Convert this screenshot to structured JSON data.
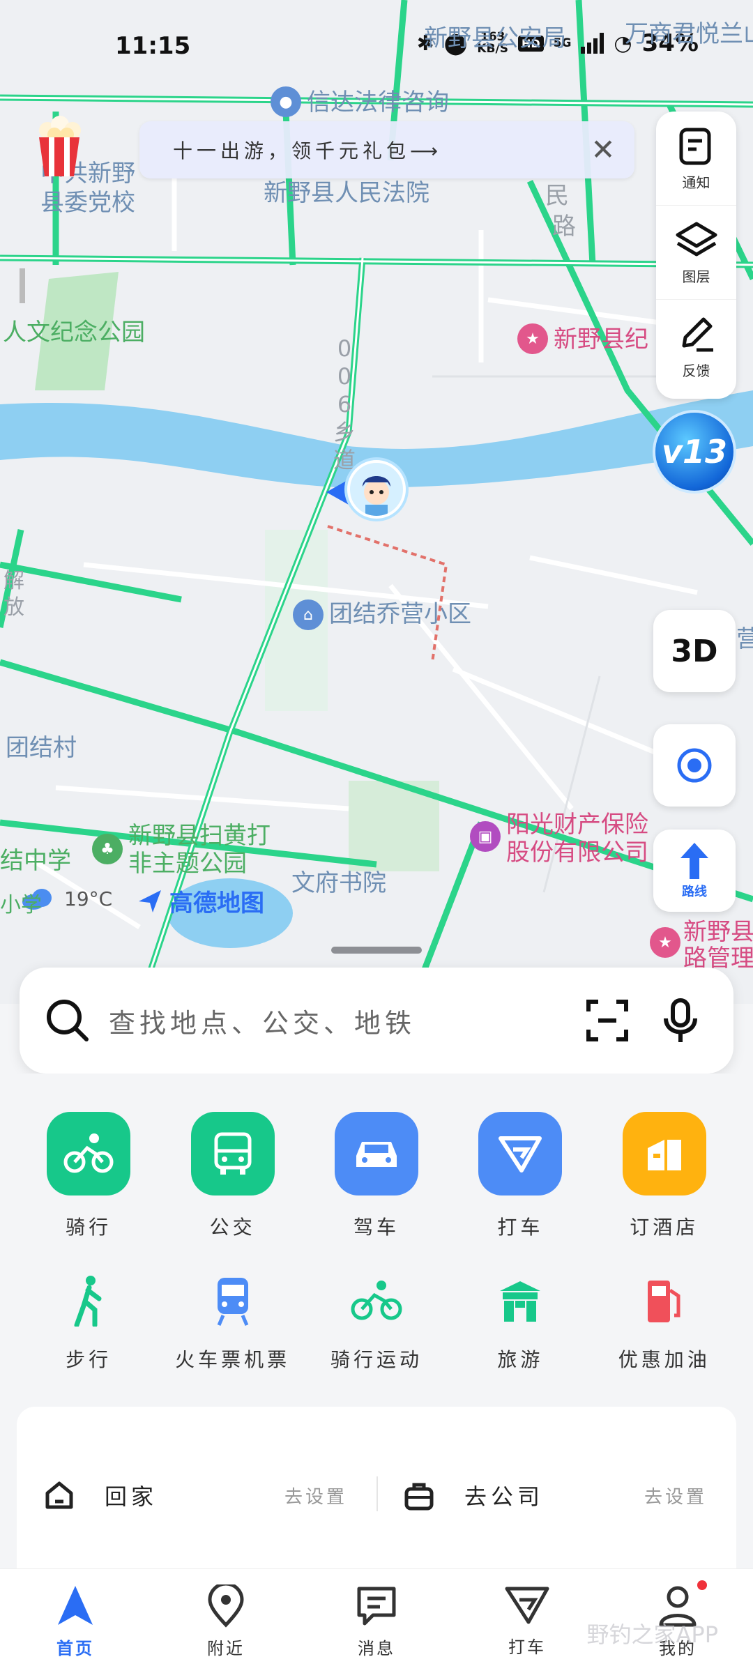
{
  "status_bar": {
    "time": "11:15",
    "net_speed": "163",
    "net_unit": "KB/S",
    "hd": "HD",
    "network": "5G",
    "battery": "34%"
  },
  "map": {
    "labels": {
      "public_security": "新野县公安局",
      "hotel": "万商君悦兰山",
      "law_consult": "信达法律咨询",
      "party_school_1": "中共新野",
      "party_school_2": "县委党校",
      "court": "新野县人民法院",
      "min_road_1": "民",
      "min_road_2": "路",
      "memorial_park": "人文纪念公园",
      "xinye_county": "新野县纪",
      "road_006": "006乡道",
      "jie_road": "解放",
      "community": "团结乔营小区",
      "village": "团结村",
      "theme_park_1": "新野县扫黄打",
      "theme_park_2": "非主题公园",
      "insurance_1": "阳光财产保险",
      "insurance_2": "股份有限公司",
      "academy": "文府书院",
      "school_left": "结中学",
      "school_left_2": "小学",
      "road_mgmt_1": "新野县",
      "road_mgmt_2": "路管理",
      "right_edge": "营"
    },
    "weather_temp": "19°C",
    "brand": "高德地图",
    "promo_text": "十一出游，领千元礼包⟶",
    "promo_close": "✕"
  },
  "toolbar": {
    "notice_label": "通知",
    "layers_label": "图层",
    "feedback_label": "反馈",
    "version_badge": "v13",
    "btn_3d": "3D",
    "route_label": "路线"
  },
  "search": {
    "placeholder": "查找地点、公交、地铁"
  },
  "quick_actions": {
    "row1": [
      {
        "label": "骑行",
        "color": "#17c88a"
      },
      {
        "label": "公交",
        "color": "#17c88a"
      },
      {
        "label": "驾车",
        "color": "#4d8cf6"
      },
      {
        "label": "打车",
        "color": "#4d8cf6"
      },
      {
        "label": "订酒店",
        "color": "#ffb20f"
      }
    ],
    "row2": [
      {
        "label": "步行",
        "color": "#17c88a"
      },
      {
        "label": "火车票机票",
        "color": "#4d8cf6"
      },
      {
        "label": "骑行运动",
        "color": "#17c88a"
      },
      {
        "label": "旅游",
        "color": "#17c88a"
      },
      {
        "label": "优惠加油",
        "color": "#f0505a"
      }
    ]
  },
  "favorites": {
    "home_label": "回家",
    "home_action": "去设置",
    "work_label": "去公司",
    "work_action": "去设置"
  },
  "tabs": [
    {
      "label": "首页"
    },
    {
      "label": "附近"
    },
    {
      "label": "消息"
    },
    {
      "label": "打车"
    },
    {
      "label": "我的"
    }
  ],
  "watermark": "野钓之家APP",
  "colors": {
    "accent": "#2a6df4",
    "road": "#2bd48a",
    "river": "#8ecff2"
  }
}
